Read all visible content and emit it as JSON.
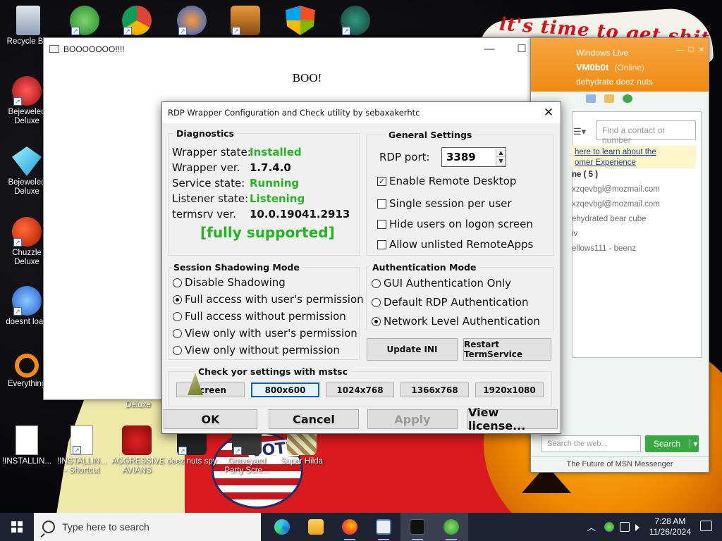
{
  "desktop": {
    "wallpaper_text": "it's time to get shit",
    "wallpaper_vote": "VOTE",
    "icons": [
      {
        "label": "Recycle Bin",
        "icon": "recycle-bin-icon"
      },
      {
        "label": "Bejeweled Deluxe",
        "icon": "bejeweled-icon"
      },
      {
        "label": "Bejeweled Deluxe",
        "icon": "bejeweled-gem-icon"
      },
      {
        "label": "Chuzzle Deluxe",
        "icon": "chuzzle-icon"
      },
      {
        "label": "doesnt load",
        "icon": "thunderbird-icon"
      },
      {
        "label": "Everything",
        "icon": "everything-icon"
      },
      {
        "label": "Deluxe",
        "icon": "game-icon"
      },
      {
        "label": "!INSTALLIN...",
        "icon": "document-icon"
      },
      {
        "label": "!INSTALLIN... - Shortcut",
        "icon": "document-shortcut-icon"
      },
      {
        "label": "AGGRESSIVE AVIANS",
        "icon": "angry-birds-icon"
      },
      {
        "label": "deez nuts spy",
        "icon": "app-icon"
      },
      {
        "label": "Graveyard Party Scre...",
        "icon": "graveyard-icon"
      },
      {
        "label": "Super Hilda",
        "icon": "hilda-icon"
      }
    ]
  },
  "boo_window": {
    "title": "BOOOOOOO!!!!",
    "body": "BOO!"
  },
  "messenger": {
    "brand": "Windows Live",
    "username": "VM0b0t",
    "status": "(Online)",
    "personal_message": "dehydrate deez nuts",
    "search_placeholder": "Find a contact or number",
    "banner_line1": "here to learn about the",
    "banner_line2": "omer Experience",
    "contacts": [
      {
        "text": "ne ( 5 )",
        "group": true
      },
      {
        "text": "xzqevbgl@mozmail.com",
        "group": false
      },
      {
        "text": "xzqevbgl@mozmail.com",
        "group": false
      },
      {
        "text": "ehydrated bear cube",
        "group": false
      },
      {
        "text": "iv",
        "group": false
      },
      {
        "text": "ellows111 - beenz",
        "group": false
      }
    ],
    "web_search_placeholder": "Search the web...",
    "web_search_button": "Search",
    "footer": "The Future of MSN Messenger"
  },
  "rdp": {
    "title": "RDP Wrapper Configuration and Check utility by sebaxakerhtc",
    "diagnostics": {
      "label": "Diagnostics",
      "rows": [
        {
          "key": "Wrapper state:",
          "value": "Installed",
          "green": true
        },
        {
          "key": "Wrapper ver.",
          "value": "1.7.4.0",
          "green": false
        },
        {
          "key": "Service state:",
          "value": "Running",
          "green": true
        },
        {
          "key": "Listener state:",
          "value": "Listening",
          "green": true
        },
        {
          "key": "termsrv ver.",
          "value": "10.0.19041.2913",
          "green": false
        }
      ],
      "support_status": "[fully supported]"
    },
    "general": {
      "label": "General Settings",
      "port_label": "RDP port:",
      "port_value": "3389",
      "options": [
        {
          "label": "Enable Remote Desktop",
          "checked": true
        },
        {
          "label": "Single session per user",
          "checked": false
        },
        {
          "label": "Hide users on logon screen",
          "checked": false
        },
        {
          "label": "Allow unlisted RemoteApps",
          "checked": false
        }
      ]
    },
    "shadowing": {
      "label": "Session Shadowing Mode",
      "options": [
        {
          "label": "Disable Shadowing",
          "selected": false
        },
        {
          "label": "Full access with user's permission",
          "selected": true
        },
        {
          "label": "Full access without permission",
          "selected": false
        },
        {
          "label": "View only with user's permission",
          "selected": false
        },
        {
          "label": "View only without permission",
          "selected": false
        }
      ]
    },
    "auth": {
      "label": "Authentication Mode",
      "options": [
        {
          "label": "GUI Authentication Only",
          "selected": false
        },
        {
          "label": "Default RDP Authentication",
          "selected": false
        },
        {
          "label": "Network Level Authentication",
          "selected": true
        }
      ]
    },
    "update_ini": "Update INI",
    "restart_service": "Restart TermService",
    "mstsc": {
      "label": "Check yor settings with mstsc",
      "resolutions": [
        "screen",
        "800x600",
        "1024x768",
        "1366x768",
        "1920x1080"
      ],
      "focused": "800x600"
    },
    "buttons": {
      "ok": "OK",
      "cancel": "Cancel",
      "apply": "Apply",
      "license": "View license..."
    }
  },
  "taskbar": {
    "search_placeholder": "Type here to search",
    "apps": [
      "edge-icon",
      "file-explorer-icon",
      "firefox-icon",
      "notepad-icon",
      "terminal-icon",
      "messenger-icon"
    ],
    "time": "7:28 AM",
    "date": "11/26/2024"
  },
  "colors": {
    "status_green": "#22b522",
    "msn_orange": "#f08a12",
    "taskbar_bg": "#1e2233"
  }
}
